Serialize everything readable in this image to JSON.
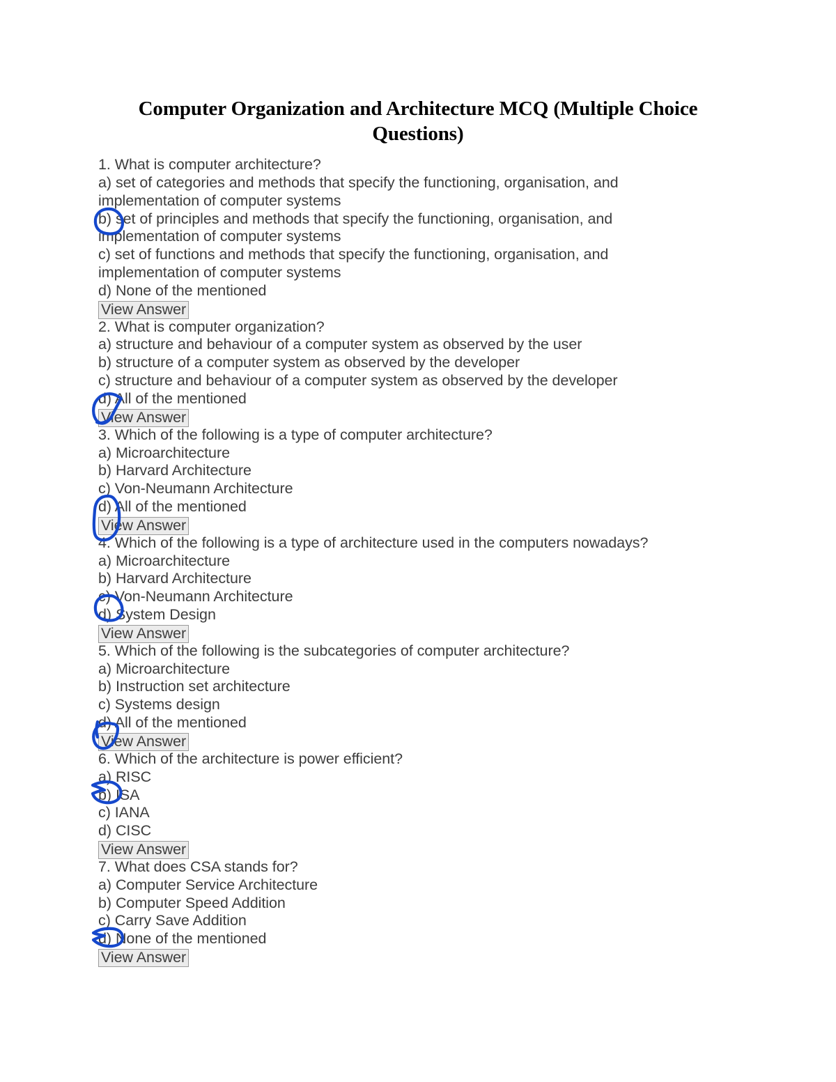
{
  "document": {
    "title": "Computer Organization and Architecture MCQ (Multiple Choice Questions)",
    "view_answer_label": "View Answer",
    "ink_color": "#1548cc",
    "text_color": "#3d3d3d",
    "title_color": "#000000",
    "button_fill": "#ebebeb",
    "button_border": "#9b9b9b",
    "page_background": "#ffffff"
  },
  "questions": [
    {
      "number": "1.",
      "prompt": "1. What is computer architecture?",
      "lines": [
        "a) set of categories and methods that specify the functioning, organisation, and",
        "implementation of computer systems",
        "b) set of principles and methods that specify the functioning, organisation, and",
        "implementation of computer systems",
        "c) set of functions and methods that specify the functioning, organisation, and",
        "implementation of computer systems",
        "d) None of the mentioned"
      ],
      "circled_option": "b)",
      "button": "View Answer"
    },
    {
      "number": "2.",
      "prompt": "2. What is computer organization?",
      "lines": [
        "a) structure and behaviour of a computer system as observed by the user",
        "b) structure of a computer system as observed by the developer",
        "c) structure and behaviour of a computer system as observed by the developer",
        "d) All of the mentioned"
      ],
      "circled_option": "d)",
      "button": "View Answer"
    },
    {
      "number": "3.",
      "prompt": "3. Which of the following is a type of computer architecture?",
      "lines": [
        "a) Microarchitecture",
        "b) Harvard Architecture",
        "c) Von-Neumann Architecture",
        "d) All of the mentioned"
      ],
      "circled_option": "d)",
      "button": "View Answer"
    },
    {
      "number": "4.",
      "prompt": "4. Which of the following is a type of architecture used in the computers nowadays?",
      "lines": [
        "a) Microarchitecture",
        "b) Harvard Architecture",
        "c) Von-Neumann Architecture",
        "d) System Design"
      ],
      "circled_option": "c)",
      "button": "View Answer"
    },
    {
      "number": "5.",
      "prompt": "5. Which of the following is the subcategories of computer architecture?",
      "lines": [
        "a) Microarchitecture",
        "b) Instruction set architecture",
        "c) Systems design",
        "d) All of the mentioned"
      ],
      "circled_option": "d)",
      "button": "View Answer"
    },
    {
      "number": "6.",
      "prompt": "6. Which of the architecture is power efficient?",
      "lines": [
        "a) RISC",
        "b) ISA",
        "c) IANA",
        "d) CISC"
      ],
      "circled_option": "a)",
      "button": "View Answer"
    },
    {
      "number": "7.",
      "prompt": "7. What does CSA stands for?",
      "lines": [
        "a) Computer Service Architecture",
        "b) Computer Speed Addition",
        "c) Carry Save Addition",
        "d) None of the mentioned"
      ],
      "circled_option": "c)",
      "button": "View Answer"
    }
  ],
  "lines_flat": [
    "1. What is computer architecture?",
    "a) set of categories and methods that specify the functioning, organisation, and",
    "implementation of computer systems",
    "b) set of principles and methods that specify the functioning, organisation, and",
    "implementation of computer systems",
    "c) set of functions and methods that specify the functioning, organisation, and",
    "implementation of computer systems",
    "d) None of the mentioned",
    "__BUTTON__",
    "2. What is computer organization?",
    "a) structure and behaviour of a computer system as observed by the user",
    "b) structure of a computer system as observed by the developer",
    "c) structure and behaviour of a computer system as observed by the developer",
    "d) All of the mentioned",
    "__BUTTON__",
    "3. Which of the following is a type of computer architecture?",
    "a) Microarchitecture",
    "b) Harvard Architecture",
    "c) Von-Neumann Architecture",
    "d) All of the mentioned",
    "__BUTTON__",
    "4. Which of the following is a type of architecture used in the computers nowadays?",
    "a) Microarchitecture",
    "b) Harvard Architecture",
    "c) Von-Neumann Architecture",
    "d) System Design",
    "__BUTTON__",
    "5. Which of the following is the subcategories of computer architecture?",
    "a) Microarchitecture",
    "b) Instruction set architecture",
    "c) Systems design",
    "d) All of the mentioned",
    "__BUTTON__",
    "6. Which of the architecture is power efficient?",
    "a) RISC",
    "b) ISA",
    "c) IANA",
    "d) CISC",
    "__BUTTON__",
    "7. What does CSA stands for?",
    "a) Computer Service Architecture",
    "b) Computer Speed Addition",
    "c) Carry Save Addition",
    "d) None of the mentioned",
    "__BUTTON__"
  ]
}
